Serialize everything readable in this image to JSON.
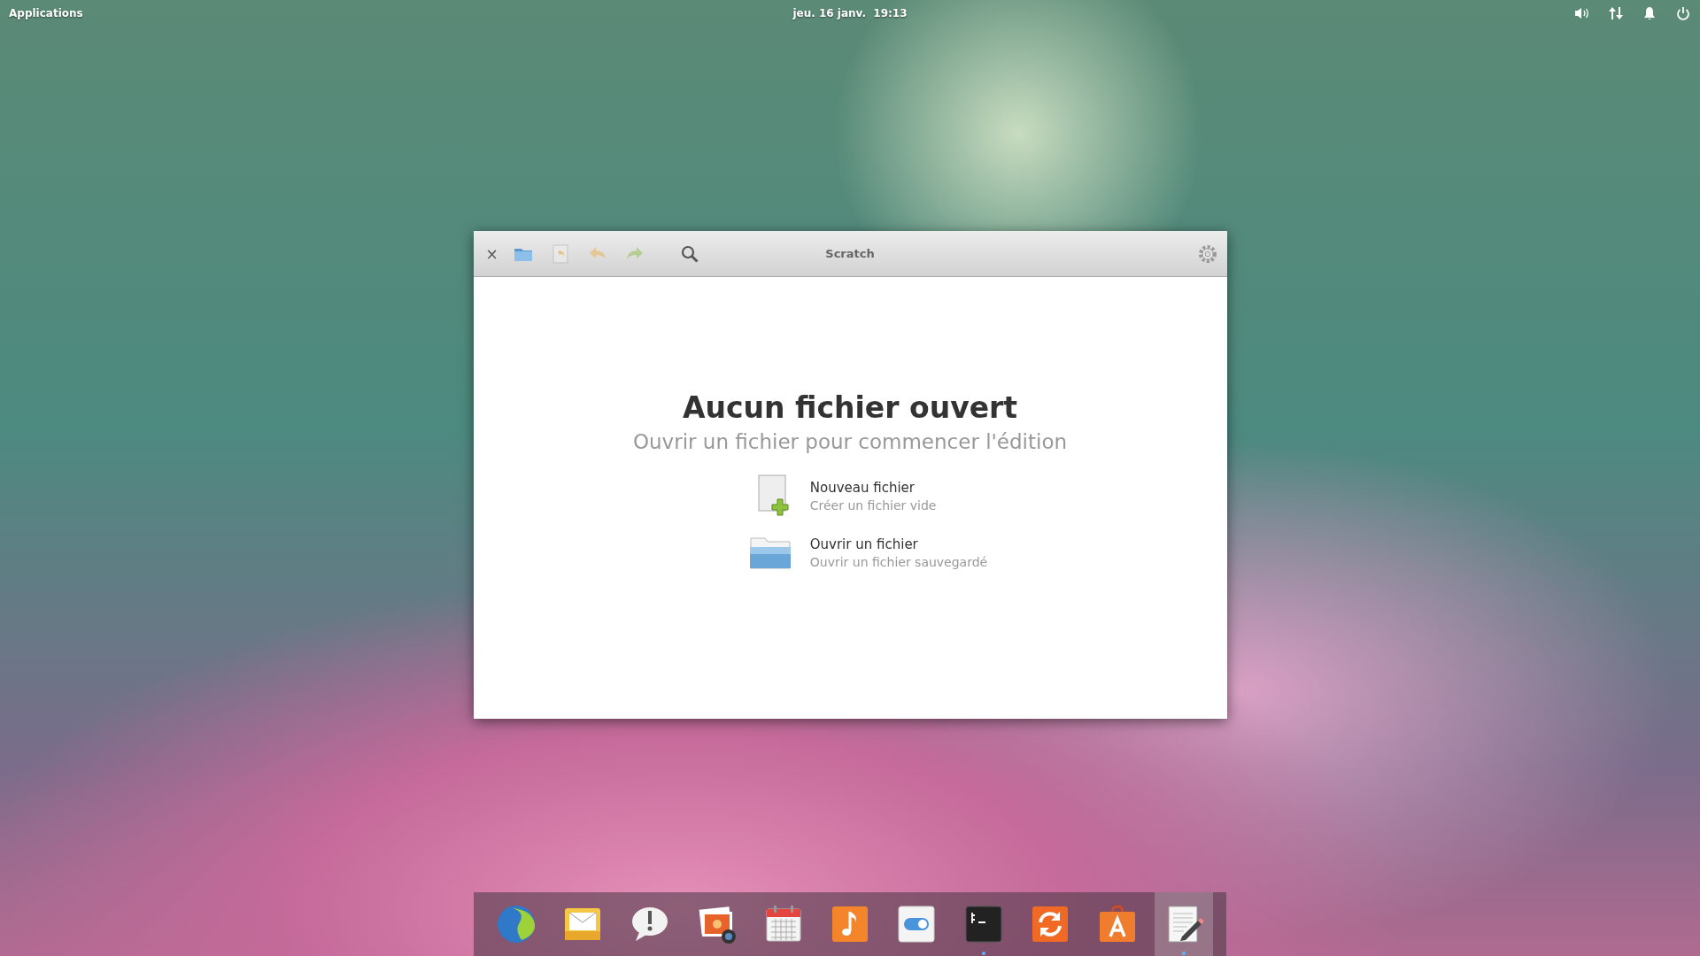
{
  "top_panel": {
    "applications": "Applications",
    "clock": "jeu. 16 janv.  19:13",
    "indicators": [
      {
        "kind": "volume"
      },
      {
        "kind": "network"
      },
      {
        "kind": "notifications"
      },
      {
        "kind": "power"
      }
    ]
  },
  "window": {
    "close": "×",
    "title": "Scratch",
    "toolbar": [
      {
        "kind": "open",
        "disabled": false
      },
      {
        "kind": "revert",
        "disabled": true
      },
      {
        "kind": "undo",
        "disabled": true
      },
      {
        "kind": "redo",
        "disabled": true
      },
      {
        "kind": "search",
        "disabled": false
      }
    ],
    "welcome": {
      "title": "Aucun fichier ouvert",
      "subtitle": "Ouvrir un fichier pour commencer l'édition",
      "actions": [
        {
          "kind": "new",
          "title": "Nouveau fichier",
          "description": "Créer un fichier vide"
        },
        {
          "kind": "open",
          "title": "Ouvrir un fichier",
          "description": "Ouvrir un fichier sauvegardé"
        }
      ]
    }
  },
  "dock": [
    {
      "kind": "browser",
      "running": false,
      "selected": false
    },
    {
      "kind": "mail",
      "running": false,
      "selected": false
    },
    {
      "kind": "chat",
      "running": false,
      "selected": false
    },
    {
      "kind": "photos",
      "running": false,
      "selected": false
    },
    {
      "kind": "calendar",
      "running": false,
      "selected": false
    },
    {
      "kind": "music",
      "running": false,
      "selected": false
    },
    {
      "kind": "settings",
      "running": false,
      "selected": false
    },
    {
      "kind": "terminal",
      "running": true,
      "selected": false
    },
    {
      "kind": "updates",
      "running": false,
      "selected": false
    },
    {
      "kind": "store",
      "running": false,
      "selected": false
    },
    {
      "kind": "editor",
      "running": true,
      "selected": true
    }
  ]
}
